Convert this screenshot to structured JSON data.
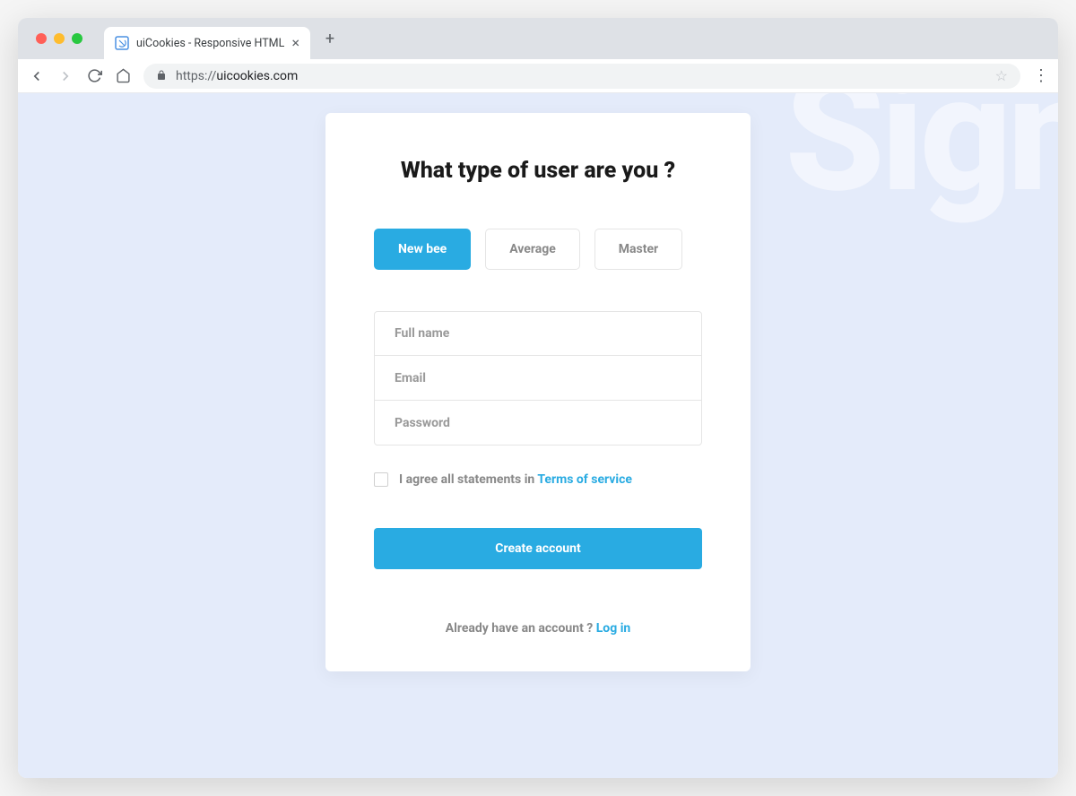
{
  "browser": {
    "tab_title": "uiCookies - Responsive HTML",
    "url_protocol": "https://",
    "url_host": "uicookies.com"
  },
  "page": {
    "bg_text": "Sign",
    "heading": "What type of user are you ?",
    "user_types": {
      "newbee": "New bee",
      "average": "Average",
      "master": "Master"
    },
    "placeholders": {
      "fullname": "Full name",
      "email": "Email",
      "password": "Password"
    },
    "terms": {
      "prefix": "I agree all statements in ",
      "link": "Terms of service"
    },
    "submit_label": "Create account",
    "login": {
      "prefix": "Already have an account ? ",
      "link": "Log in"
    }
  }
}
